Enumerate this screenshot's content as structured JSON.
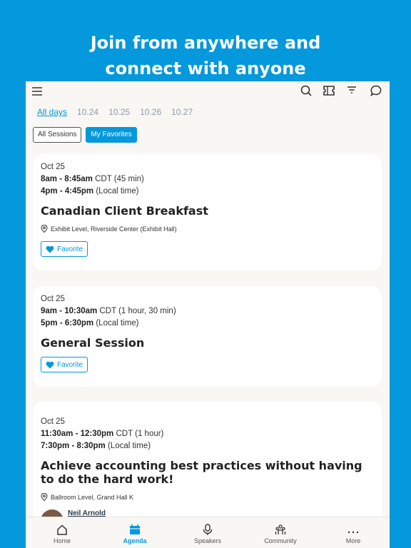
{
  "hero": {
    "line1": "Join from anywhere and",
    "line2": "connect with anyone"
  },
  "colors": {
    "accent": "#0498dc"
  },
  "toolbar": {
    "icons": [
      "menu-icon",
      "search-icon",
      "ticket-icon",
      "filter-icon",
      "chat-icon"
    ]
  },
  "days": [
    "All days",
    "10.24",
    "10.25",
    "10.26",
    "10.27"
  ],
  "filters": {
    "all": "All Sessions",
    "favorites": "My Favorites"
  },
  "sessions": [
    {
      "date": "Oct 25",
      "time1": "8am - 8:45am",
      "tz1": "CDT (45 min)",
      "time2": "4pm - 4:45pm",
      "tz2": "(Local time)",
      "title": "Canadian Client Breakfast",
      "location": "Exhibit Level, Riverside Center (Exhibit Hall)",
      "favorite": "Favorite"
    },
    {
      "date": "Oct 25",
      "time1": "9am - 10:30am",
      "tz1": "CDT (1 hour, 30 min)",
      "time2": "5pm - 6:30pm",
      "tz2": "(Local time)",
      "title": "General Session",
      "favorite": "Favorite"
    },
    {
      "date": "Oct 25",
      "time1": "11:30am - 12:30pm",
      "tz1": "CDT (1 hour)",
      "time2": "7:30pm - 8:30pm",
      "tz2": "(Local time)",
      "title": "Achieve accounting best practices without having to do the hard work!",
      "location": "Ballroom Level, Grand Hall K",
      "speaker": "Neil Arnold"
    }
  ],
  "nav": [
    {
      "label": "Home"
    },
    {
      "label": "Agenda",
      "active": true
    },
    {
      "label": "Speakers"
    },
    {
      "label": "Community"
    },
    {
      "label": "More"
    }
  ]
}
